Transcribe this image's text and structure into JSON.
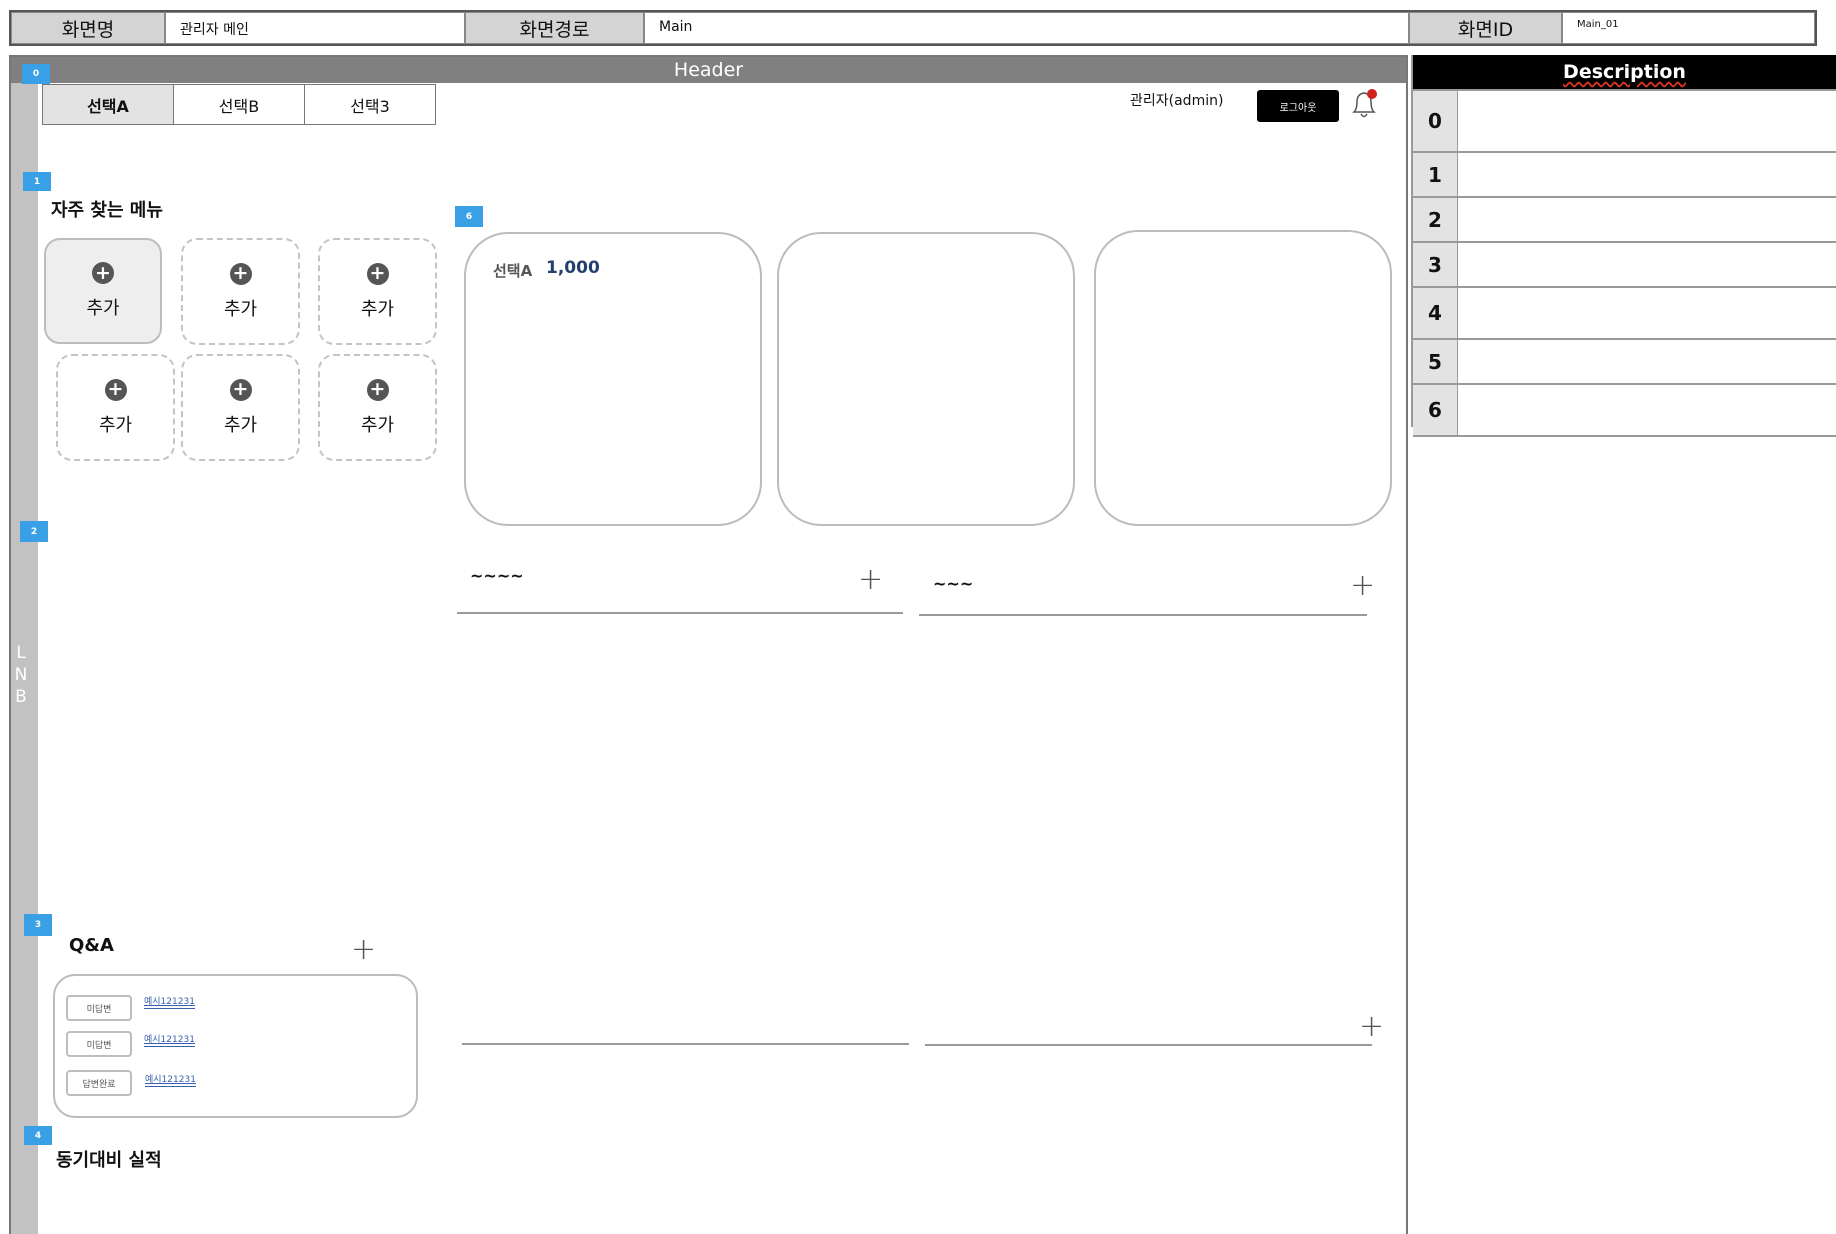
{
  "info_bar": {
    "screen_name_label": "화면명",
    "screen_name_value": "관리자 메인",
    "screen_path_label": "화면경로",
    "screen_path_value": "Main",
    "screen_id_label": "화면ID",
    "screen_id_value": "Main_01"
  },
  "header": {
    "title": "Header"
  },
  "lnb": {
    "letters": [
      "L",
      "N",
      "B"
    ]
  },
  "badges": [
    "0",
    "1",
    "2",
    "3",
    "4",
    "6"
  ],
  "tabs": [
    {
      "label": "선택A",
      "active": true
    },
    {
      "label": "선택B",
      "active": false
    },
    {
      "label": "선택3",
      "active": false
    }
  ],
  "user": {
    "name": "관리자(admin)",
    "logout_label": "로그아웃",
    "notification_dot_color": "#d0211c"
  },
  "favorites": {
    "title": "자주 찾는 메뉴",
    "items": [
      {
        "label": "추가",
        "filled": true
      },
      {
        "label": "추가",
        "filled": false
      },
      {
        "label": "추가",
        "filled": false
      },
      {
        "label": "추가",
        "filled": false
      },
      {
        "label": "추가",
        "filled": false
      },
      {
        "label": "추가",
        "filled": false
      }
    ]
  },
  "cards": [
    {
      "label": "선택A",
      "value": "1,000",
      "value_color": "#24406e"
    },
    {
      "label": "",
      "value": ""
    },
    {
      "label": "",
      "value": ""
    }
  ],
  "lists": [
    {
      "title": "~~~~"
    },
    {
      "title": "~~~"
    }
  ],
  "qa": {
    "title": "Q&A",
    "items": [
      {
        "status": "미답변",
        "link": "예시121231"
      },
      {
        "status": "미답변",
        "link": "예시121231"
      },
      {
        "status": "답변완료",
        "link": "예시121231"
      }
    ]
  },
  "yoy": {
    "title": "동기대비 실적"
  },
  "description": {
    "header": "Description",
    "rows": [
      "0",
      "1",
      "2",
      "3",
      "4",
      "5",
      "6"
    ]
  }
}
